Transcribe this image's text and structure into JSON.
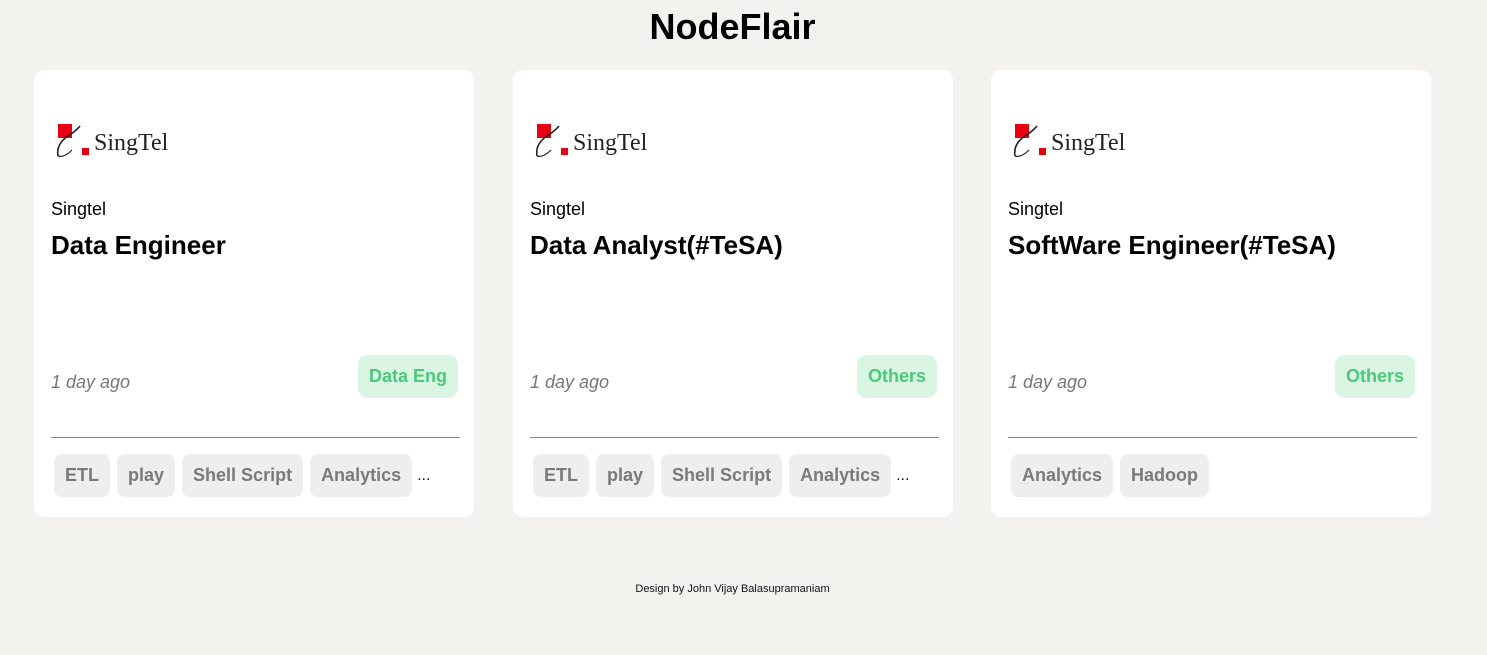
{
  "site": {
    "title": "NodeFlair"
  },
  "colors": {
    "background": "#f3f2ef",
    "card": "#ffffff",
    "category_bg": "#daf5e3",
    "category_text": "#4cc87a",
    "tag_bg": "#eeeeee",
    "tag_text": "#7a7a7a",
    "brand_red": "#e60012"
  },
  "cards": [
    {
      "logo_icon": "singtel-logo",
      "logo_text": "SingTel",
      "company": "Singtel",
      "title": "Data Engineer",
      "posted": "1 day ago",
      "category": "Data Eng",
      "tags": [
        "ETL",
        "play",
        "Shell Script",
        "Analytics"
      ],
      "more": "..."
    },
    {
      "logo_icon": "singtel-logo",
      "logo_text": "SingTel",
      "company": "Singtel",
      "title": "Data Analyst(#TeSA)",
      "posted": "1 day ago",
      "category": "Others",
      "tags": [
        "ETL",
        "play",
        "Shell Script",
        "Analytics"
      ],
      "more": "..."
    },
    {
      "logo_icon": "singtel-logo",
      "logo_text": "SingTel",
      "company": "Singtel",
      "title": "SoftWare Engineer(#TeSA)",
      "posted": "1 day ago",
      "category": "Others",
      "tags": [
        "Analytics",
        "Hadoop"
      ]
    }
  ],
  "footer": {
    "credit": "Design by John Vijay Balasupramaniam"
  }
}
